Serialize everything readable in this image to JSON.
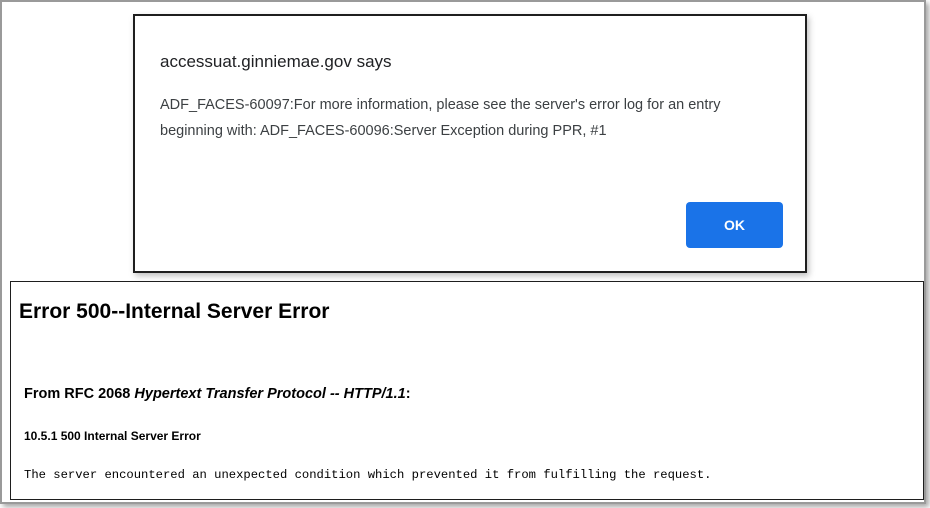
{
  "dialog": {
    "title": "accessuat.ginniemae.gov says",
    "message": "ADF_FACES-60097:For more information, please see the server's error log for an entry beginning with: ADF_FACES-60096:Server Exception during PPR, #1",
    "ok_label": "OK",
    "button_color": "#1a73e8"
  },
  "error_page": {
    "title": "Error 500--Internal Server Error",
    "rfc_prefix": "From RFC 2068 ",
    "rfc_italic": "Hypertext Transfer Protocol -- HTTP/1.1",
    "rfc_suffix": ":",
    "section_heading": "10.5.1 500 Internal Server Error",
    "body": "The server encountered an unexpected condition which prevented it from fulfilling the request."
  }
}
